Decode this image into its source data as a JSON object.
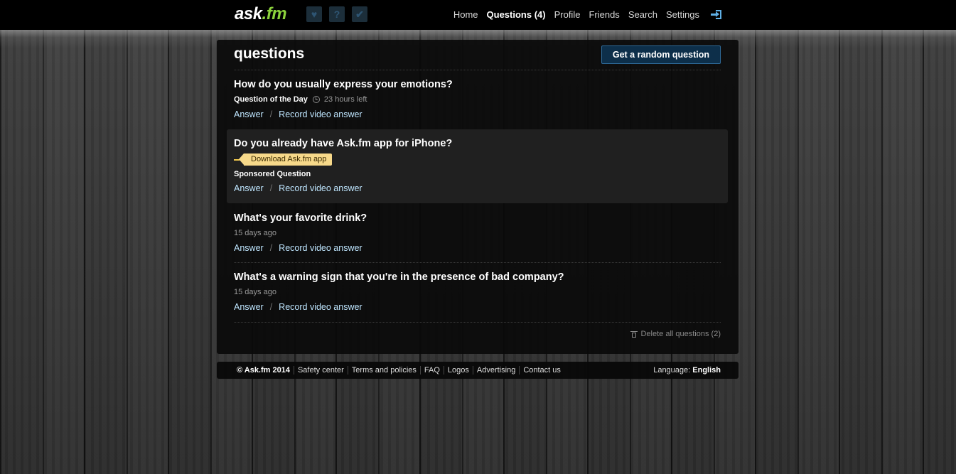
{
  "header": {
    "logo_main": "ask",
    "logo_accent": ".fm",
    "quick_icons": [
      "heart-icon",
      "question-icon",
      "check-icon"
    ],
    "nav": [
      {
        "label": "Home"
      },
      {
        "label": "Questions (4)",
        "active": true
      },
      {
        "label": "Profile"
      },
      {
        "label": "Friends"
      },
      {
        "label": "Search"
      },
      {
        "label": "Settings"
      }
    ],
    "logout_icon": "logout-icon"
  },
  "main": {
    "title": "questions",
    "random_button": "Get a random question",
    "questions": [
      {
        "title": "How do you usually express your emotions?",
        "meta_label": "Question of the Day",
        "meta_time": "23 hours left",
        "answer": "Answer",
        "video": "Record video answer"
      },
      {
        "title": "Do you already have Ask.fm app for iPhone?",
        "tag": "Download Ask.fm app",
        "sponsored_label": "Sponsored Question",
        "answer": "Answer",
        "video": "Record video answer"
      },
      {
        "title": "What's your favorite drink?",
        "meta_time": "15 days ago",
        "answer": "Answer",
        "video": "Record video answer"
      },
      {
        "title": "What's a warning sign that you're in the presence of bad company?",
        "meta_time": "15 days ago",
        "answer": "Answer",
        "video": "Record video answer"
      }
    ],
    "delete_all": "Delete all questions (2)"
  },
  "footer": {
    "links": [
      "© Ask.fm 2014",
      "Safety center",
      "Terms and policies",
      "FAQ",
      "Logos",
      "Advertising",
      "Contact us"
    ],
    "language_label": "Language:",
    "language_value": "English"
  },
  "colors": {
    "accent_green": "#8cd23c",
    "link_blue": "#bfe6ff",
    "button_bg": "#0d2f4a",
    "tag_yellow": "#f7d98a"
  }
}
